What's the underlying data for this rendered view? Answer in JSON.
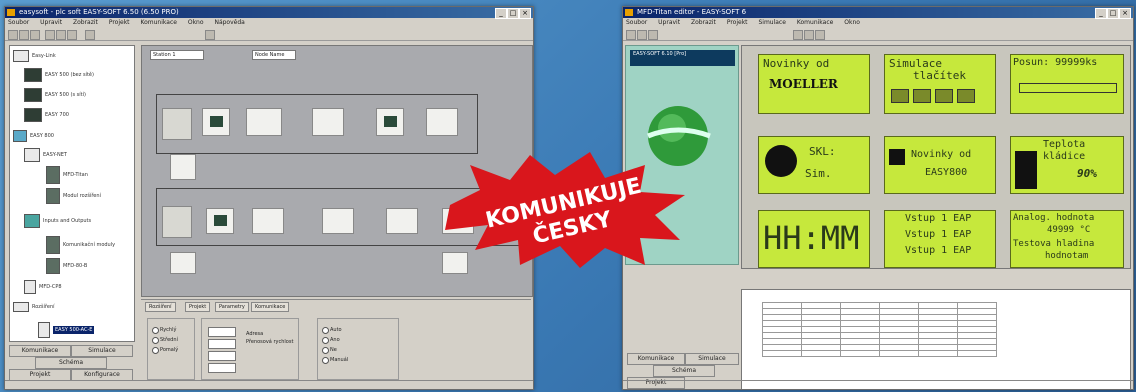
{
  "left_window": {
    "title": "easysoft - plc soft EASY-SOFT 6.50 (6.50 PRO)",
    "menu": [
      "Soubor",
      "Upravit",
      "Zobrazit",
      "Projekt",
      "Komunikace",
      "Okno",
      "Nápověda"
    ],
    "tree": {
      "items": [
        "Easy-Link",
        "EASY 500 (bez sítě)",
        "EASY 500 (s sítí)",
        "EASY 700",
        "EASY 800",
        "EASY-NET",
        "MFD-Titan",
        "Modul rozšíření",
        "Inputs and Outputs",
        "Komunikační moduly",
        "MFD-80-B",
        "MFD-CP8",
        "Rozšíření",
        "EASY 500-AC-E"
      ],
      "buttons": [
        "Komunikace",
        "Simulace",
        "Schéma",
        "Projekt",
        "Konfigurace"
      ]
    },
    "canvas": {
      "station_label": "Station 1",
      "node_label": "Node Name"
    },
    "props": {
      "tabs": [
        "Rozšíření",
        "Projekt",
        "Parametry",
        "Komunikace"
      ],
      "group1_options": [
        "Rychlý",
        "Střední",
        "Pomalý"
      ],
      "group2_labels": [
        "Adresa",
        "Přenosová rychlost"
      ],
      "group3_options": [
        "Auto",
        "Ano",
        "Ne",
        "Manuál"
      ]
    }
  },
  "right_window": {
    "title": "MFD-Titan editor - EASY-SOFT 6",
    "menu": [
      "Soubor",
      "Upravit",
      "Zobrazit",
      "Projekt",
      "Simulace",
      "Komunikace",
      "Okno"
    ],
    "side_header": "EASY-SOFT 6.10 [Pro]",
    "lcd_texts": {
      "a": "Novinky od",
      "b": "Simulace",
      "b2": "tlačítek",
      "c": "Posun: 99999ks",
      "d": "SKL:",
      "d2": "Sim.",
      "e": "Novinky od",
      "e2": "EASY800",
      "f": "Teplota",
      "f2": "kládice",
      "f3": "90%",
      "g": "HH:MM",
      "h1": "Vstup 1 EAP",
      "h2": "Vstup 1 EAP",
      "h3": "Vstup 1 EAP",
      "i1": "Analog. hodnota",
      "i2": "49999 °C",
      "i3": "Testova hladina",
      "i4": "hodnotam"
    },
    "moeller_text": "MOELLER",
    "buttons": [
      "Komunikace",
      "Simulace",
      "Schéma",
      "Projekt"
    ]
  },
  "badge": {
    "line1": "KOMUNIKUJE",
    "line2": "ČESKY",
    "color": "#d9161c"
  }
}
